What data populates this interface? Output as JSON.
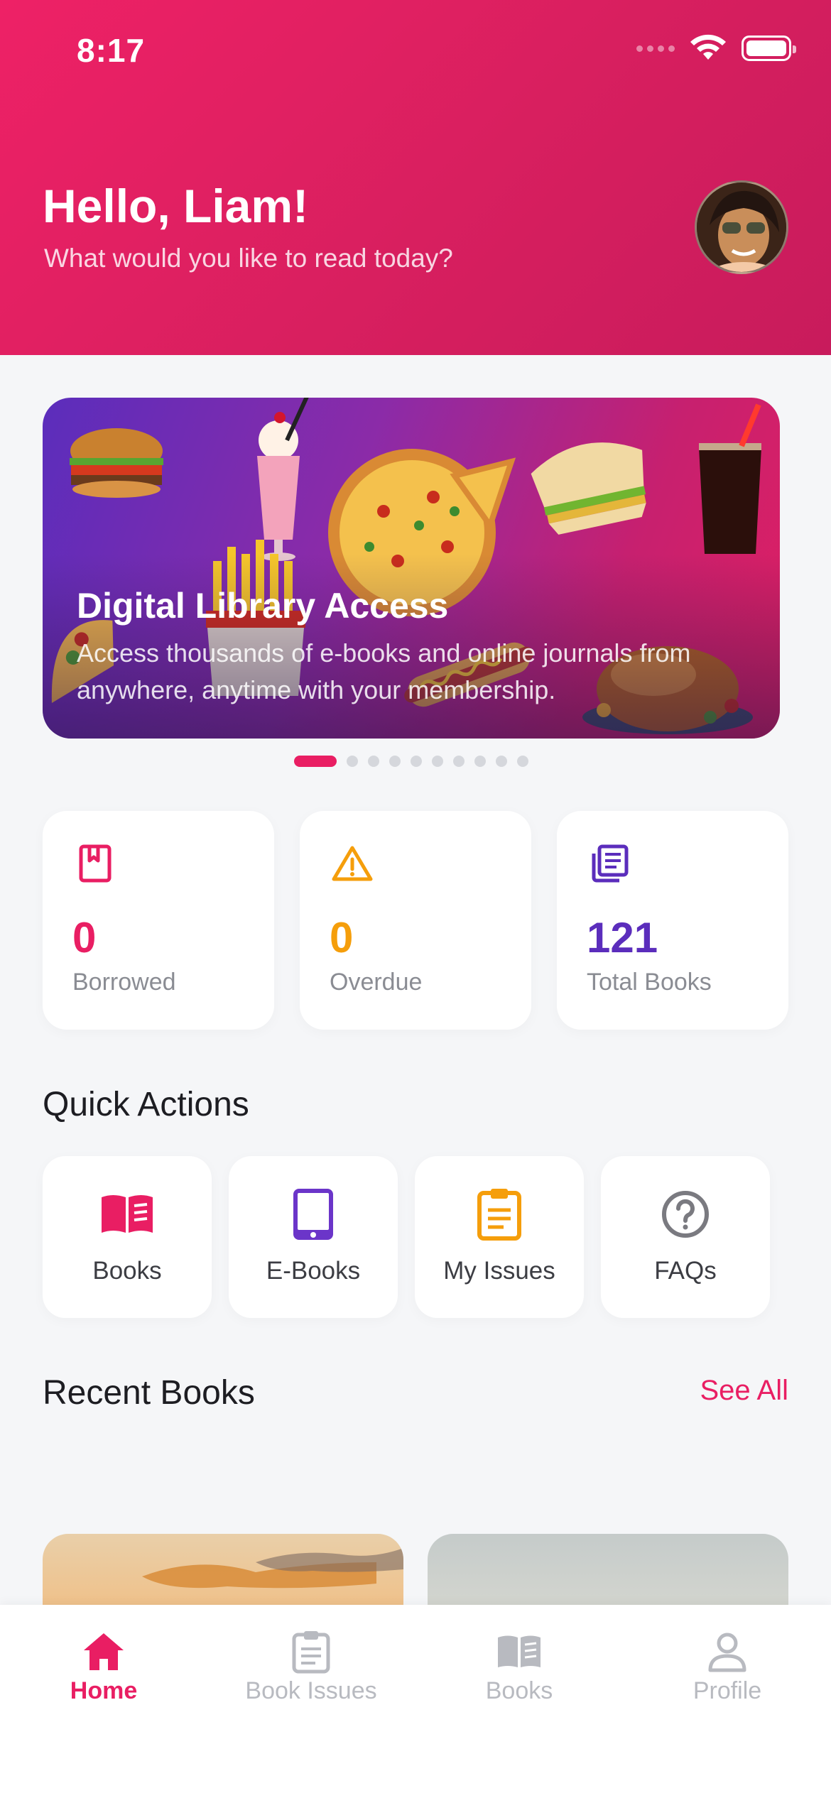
{
  "status_bar": {
    "time": "8:17"
  },
  "header": {
    "greeting": "Hello, Liam!",
    "subtitle": "What would you like to read today?",
    "avatar_icon": "user-avatar"
  },
  "banner": {
    "title": "Digital Library Access",
    "description": "Access thousands of e-books and online journals from anywhere, anytime with your membership.",
    "slide_count": 10,
    "active_slide": 1
  },
  "stats": [
    {
      "value": "0",
      "label": "Borrowed",
      "icon": "bookmark-book-icon",
      "color": "#e91e63"
    },
    {
      "value": "0",
      "label": "Overdue",
      "icon": "warning-icon",
      "color": "#f59e0b"
    },
    {
      "value": "121",
      "label": "Total Books",
      "icon": "library-icon",
      "color": "#5b2dbc"
    }
  ],
  "quick_actions": {
    "title": "Quick Actions",
    "items": [
      {
        "label": "Books",
        "icon": "open-book-icon",
        "color": "#e91e63"
      },
      {
        "label": "E-Books",
        "icon": "tablet-icon",
        "color": "#6b35c9"
      },
      {
        "label": "My Issues",
        "icon": "clipboard-icon",
        "color": "#f59e0b"
      },
      {
        "label": "FAQs",
        "icon": "help-circle-icon",
        "color": "#7a7a80"
      }
    ]
  },
  "recent_books": {
    "title": "Recent Books",
    "see_all": "See All"
  },
  "tab_bar": {
    "tabs": [
      {
        "label": "Home",
        "icon": "home-icon",
        "active": true
      },
      {
        "label": "Book Issues",
        "icon": "clipboard-icon",
        "active": false
      },
      {
        "label": "Books",
        "icon": "open-book-icon",
        "active": false
      },
      {
        "label": "Profile",
        "icon": "profile-icon",
        "active": false
      }
    ]
  },
  "colors": {
    "primary": "#e91e63",
    "warning": "#f59e0b",
    "purple": "#5b2dbc",
    "background": "#f5f6f8"
  }
}
